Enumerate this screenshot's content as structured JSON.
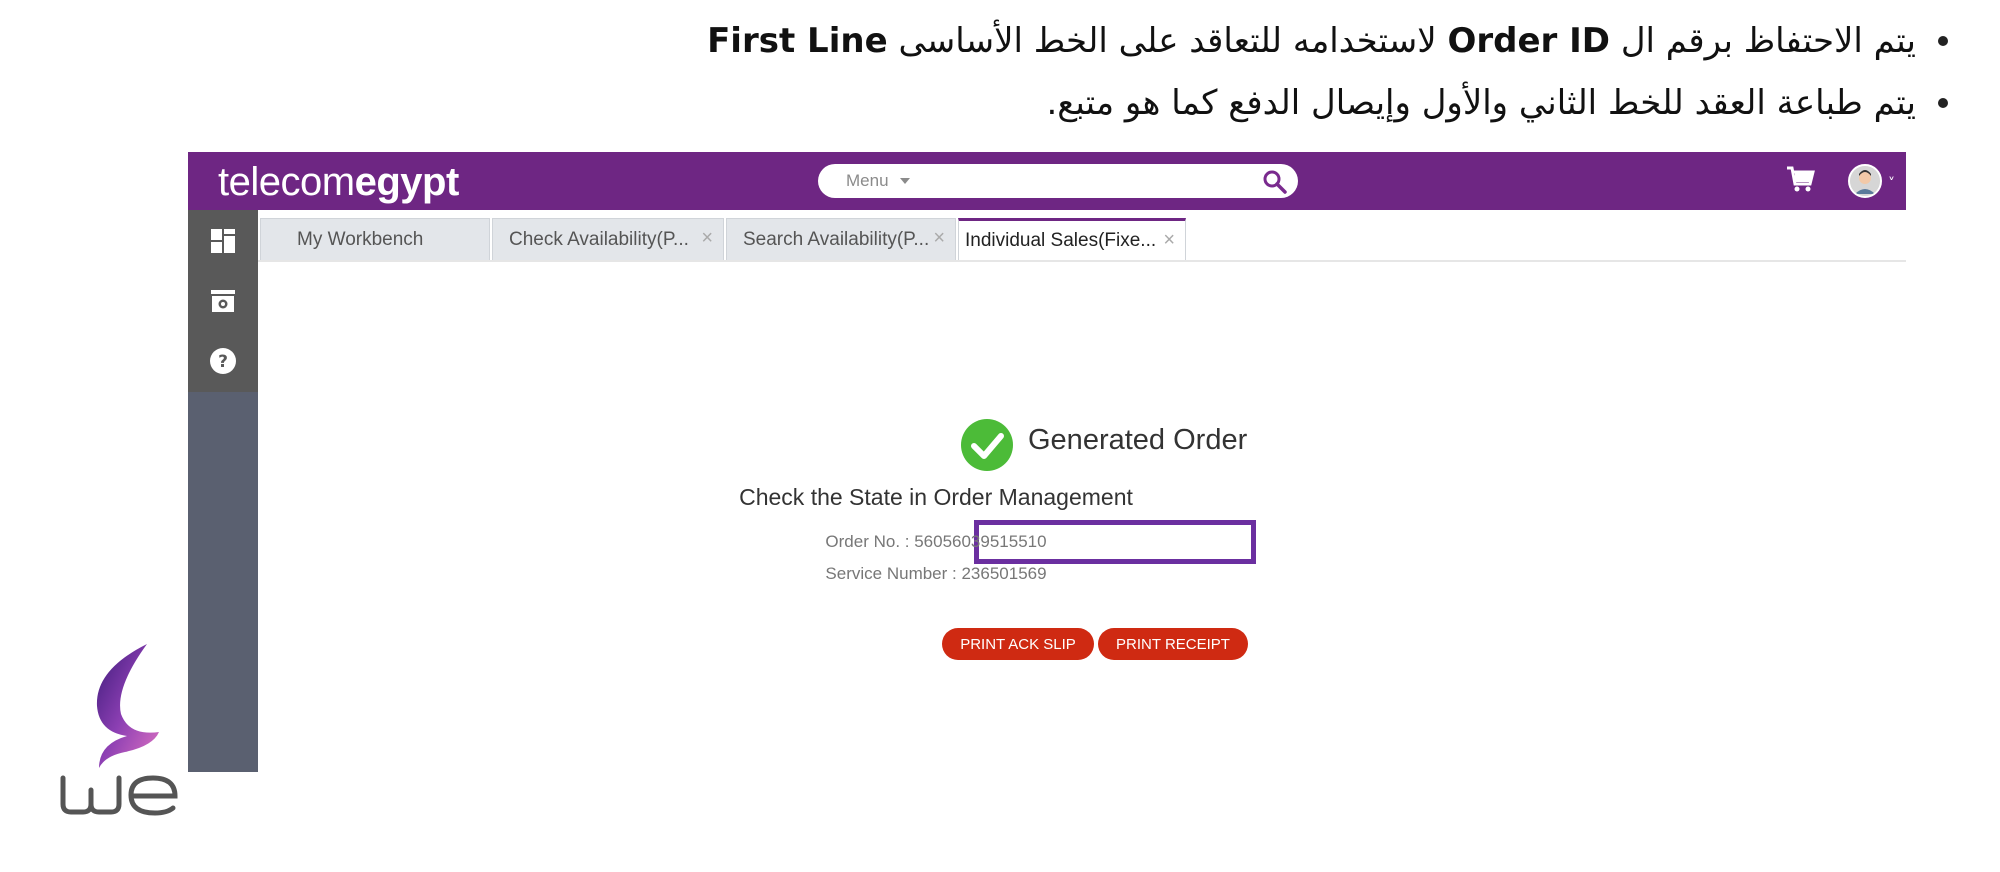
{
  "bullets": [
    {
      "pre": "يتم الاحتفاظ برقم ال",
      "b1": "Order ID",
      "mid": "لاستخدامه للتعاقد على الخط الأساسى",
      "b2": "First Line"
    },
    {
      "text": "يتم طباعة العقد للخط الثاني والأول وإيصال الدفع كما هو متبع."
    }
  ],
  "app": {
    "logo_light": "tele",
    "logo_mid": "com",
    "logo_bold": "egypt",
    "menu_label": "Menu",
    "tabs": [
      {
        "label": "My Workbench"
      },
      {
        "label": "Check Availability(P..."
      },
      {
        "label": "Search Availability(P..."
      },
      {
        "label": "Individual Sales(Fixe..."
      }
    ],
    "tab_close_glyph": "×",
    "result": {
      "title": "Generated Order",
      "message": "Check the State in Order Management",
      "order_no": "Order No. : 56056039515510",
      "service_number": "Service Number : 236501569",
      "btn_ack": "PRINT ACK SLIP",
      "btn_receipt": "PRINT RECEIPT"
    }
  },
  "icons": [
    "search-icon",
    "cart-icon",
    "dashboard-icon",
    "view-icon",
    "help-icon",
    "check-circle-icon",
    "we-logo"
  ],
  "colors": {
    "brand": "#6e2683",
    "highlight_box": "#6b2fa0",
    "button": "#cf2a12",
    "success": "#4cbb38"
  }
}
